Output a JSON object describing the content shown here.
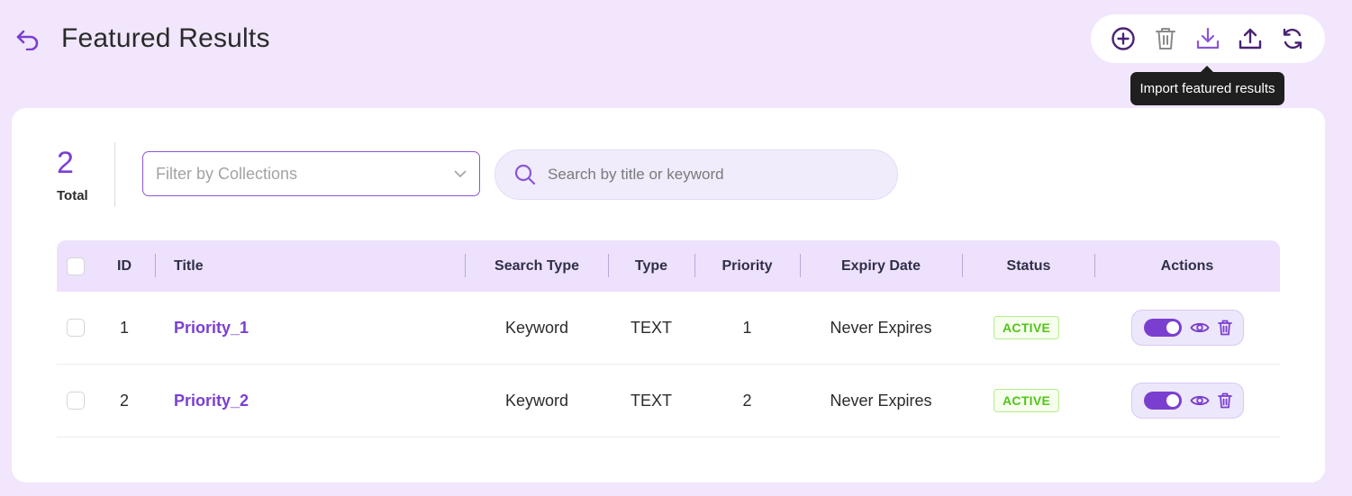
{
  "header": {
    "title": "Featured Results",
    "back_icon": "back-arrow-icon"
  },
  "toolbar": {
    "buttons": [
      {
        "name": "add",
        "icon": "plus-circle-icon"
      },
      {
        "name": "delete",
        "icon": "trash-icon"
      },
      {
        "name": "import",
        "icon": "download-icon"
      },
      {
        "name": "export",
        "icon": "upload-icon"
      },
      {
        "name": "refresh",
        "icon": "refresh-icon"
      }
    ],
    "tooltip": "Import featured results"
  },
  "summary": {
    "count": "2",
    "label": "Total"
  },
  "filters": {
    "collections_placeholder": "Filter by Collections",
    "search_placeholder": "Search by title or keyword"
  },
  "table": {
    "headers": {
      "id": "ID",
      "title": "Title",
      "search_type": "Search Type",
      "type": "Type",
      "priority": "Priority",
      "expiry": "Expiry Date",
      "status": "Status",
      "actions": "Actions"
    },
    "rows": [
      {
        "id": "1",
        "title": "Priority_1",
        "search_type": "Keyword",
        "type": "TEXT",
        "priority": "1",
        "expiry": "Never Expires",
        "status": "ACTIVE",
        "enabled": true
      },
      {
        "id": "2",
        "title": "Priority_2",
        "search_type": "Keyword",
        "type": "TEXT",
        "priority": "2",
        "expiry": "Never Expires",
        "status": "ACTIVE",
        "enabled": true
      }
    ]
  },
  "colors": {
    "accent": "#7b3fd0",
    "background": "#f1e6fc",
    "header_row": "#ede1fd",
    "status_active": "#52c41a"
  }
}
